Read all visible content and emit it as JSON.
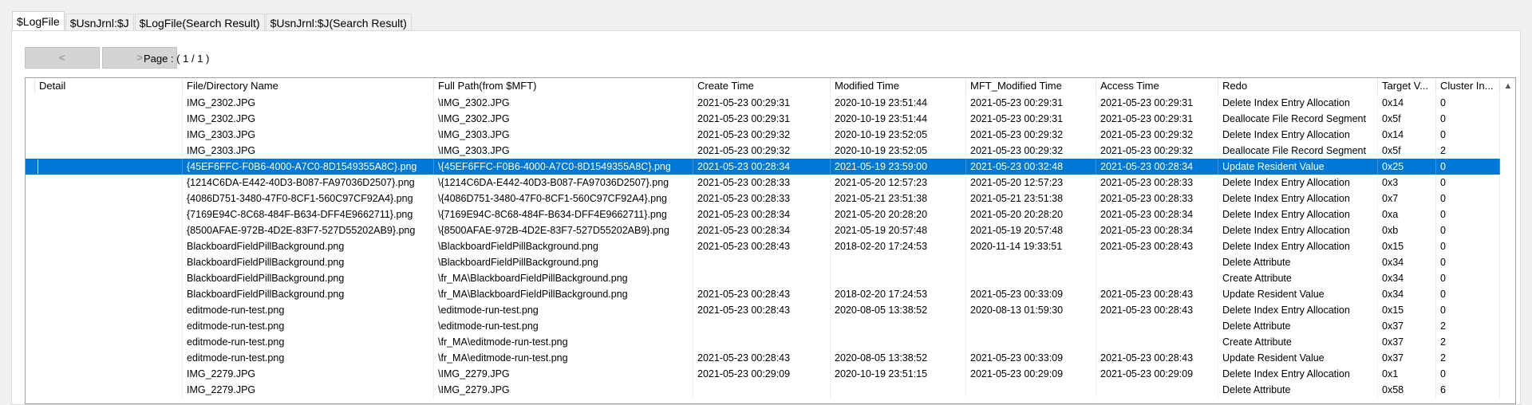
{
  "tabs": [
    "$LogFile",
    "$UsnJrnl:$J",
    "$LogFile(Search Result)",
    "$UsnJrnl:$J(Search Result)"
  ],
  "nav": {
    "prev": "<",
    "next": ">",
    "page": "Page : ( 1 / 1 )"
  },
  "table": {
    "columns": [
      "",
      "Detail",
      "File/Directory Name",
      "Full Path(from $MFT)",
      "Create Time",
      "Modified Time",
      "MFT_Modified Time",
      "Access Time",
      "Redo",
      "Target V...",
      "Cluster In..."
    ],
    "selected_row": 4,
    "rows": [
      [
        "",
        "",
        "IMG_2302.JPG",
        "\\IMG_2302.JPG",
        "2021-05-23 00:29:31",
        "2020-10-19 23:51:44",
        "2021-05-23 00:29:31",
        "2021-05-23 00:29:31",
        "Delete Index Entry Allocation",
        "0x14",
        "0"
      ],
      [
        "",
        "",
        "IMG_2302.JPG",
        "\\IMG_2302.JPG",
        "2021-05-23 00:29:31",
        "2020-10-19 23:51:44",
        "2021-05-23 00:29:31",
        "2021-05-23 00:29:31",
        "Deallocate File Record Segment",
        "0x5f",
        "0"
      ],
      [
        "",
        "",
        "IMG_2303.JPG",
        "\\IMG_2303.JPG",
        "2021-05-23 00:29:32",
        "2020-10-19 23:52:05",
        "2021-05-23 00:29:32",
        "2021-05-23 00:29:32",
        "Delete Index Entry Allocation",
        "0x14",
        "0"
      ],
      [
        "",
        "",
        "IMG_2303.JPG",
        "\\IMG_2303.JPG",
        "2021-05-23 00:29:32",
        "2020-10-19 23:52:05",
        "2021-05-23 00:29:32",
        "2021-05-23 00:29:32",
        "Deallocate File Record Segment",
        "0x5f",
        "2"
      ],
      [
        "",
        "",
        "{45EF6FFC-F0B6-4000-A7C0-8D1549355A8C}.png",
        "\\{45EF6FFC-F0B6-4000-A7C0-8D1549355A8C}.png",
        "2021-05-23 00:28:34",
        "2021-05-19 23:59:00",
        "2021-05-23 00:32:48",
        "2021-05-23 00:28:34",
        "Update Resident Value",
        "0x25",
        "0"
      ],
      [
        "",
        "",
        "{1214C6DA-E442-40D3-B087-FA97036D2507}.png",
        "\\{1214C6DA-E442-40D3-B087-FA97036D2507}.png",
        "2021-05-23 00:28:33",
        "2021-05-20 12:57:23",
        "2021-05-20 12:57:23",
        "2021-05-23 00:28:33",
        "Delete Index Entry Allocation",
        "0x3",
        "0"
      ],
      [
        "",
        "",
        "{4086D751-3480-47F0-8CF1-560C97CF92A4}.png",
        "\\{4086D751-3480-47F0-8CF1-560C97CF92A4}.png",
        "2021-05-23 00:28:33",
        "2021-05-21 23:51:38",
        "2021-05-21 23:51:38",
        "2021-05-23 00:28:33",
        "Delete Index Entry Allocation",
        "0x7",
        "0"
      ],
      [
        "",
        "",
        "{7169E94C-8C68-484F-B634-DFF4E9662711}.png",
        "\\{7169E94C-8C68-484F-B634-DFF4E9662711}.png",
        "2021-05-23 00:28:34",
        "2021-05-20 20:28:20",
        "2021-05-20 20:28:20",
        "2021-05-23 00:28:34",
        "Delete Index Entry Allocation",
        "0xa",
        "0"
      ],
      [
        "",
        "",
        "{8500AFAE-972B-4D2E-83F7-527D55202AB9}.png",
        "\\{8500AFAE-972B-4D2E-83F7-527D55202AB9}.png",
        "2021-05-23 00:28:34",
        "2021-05-19 20:57:48",
        "2021-05-19 20:57:48",
        "2021-05-23 00:28:34",
        "Delete Index Entry Allocation",
        "0xb",
        "0"
      ],
      [
        "",
        "",
        "BlackboardFieldPillBackground.png",
        "\\BlackboardFieldPillBackground.png",
        "2021-05-23 00:28:43",
        "2018-02-20 17:24:53",
        "2020-11-14 19:33:51",
        "2021-05-23 00:28:43",
        "Delete Index Entry Allocation",
        "0x15",
        "0"
      ],
      [
        "",
        "",
        "BlackboardFieldPillBackground.png",
        "\\BlackboardFieldPillBackground.png",
        "",
        "",
        "",
        "",
        "Delete Attribute",
        "0x34",
        "0"
      ],
      [
        "",
        "",
        "BlackboardFieldPillBackground.png",
        "\\fr_MA\\BlackboardFieldPillBackground.png",
        "",
        "",
        "",
        "",
        "Create Attribute",
        "0x34",
        "0"
      ],
      [
        "",
        "",
        "BlackboardFieldPillBackground.png",
        "\\fr_MA\\BlackboardFieldPillBackground.png",
        "2021-05-23 00:28:43",
        "2018-02-20 17:24:53",
        "2021-05-23 00:33:09",
        "2021-05-23 00:28:43",
        "Update Resident Value",
        "0x34",
        "0"
      ],
      [
        "",
        "",
        "editmode-run-test.png",
        "\\editmode-run-test.png",
        "2021-05-23 00:28:43",
        "2020-08-05 13:38:52",
        "2020-08-13 01:59:30",
        "2021-05-23 00:28:43",
        "Delete Index Entry Allocation",
        "0x15",
        "0"
      ],
      [
        "",
        "",
        "editmode-run-test.png",
        "\\editmode-run-test.png",
        "",
        "",
        "",
        "",
        "Delete Attribute",
        "0x37",
        "2"
      ],
      [
        "",
        "",
        "editmode-run-test.png",
        "\\fr_MA\\editmode-run-test.png",
        "",
        "",
        "",
        "",
        "Create Attribute",
        "0x37",
        "2"
      ],
      [
        "",
        "",
        "editmode-run-test.png",
        "\\fr_MA\\editmode-run-test.png",
        "2021-05-23 00:28:43",
        "2020-08-05 13:38:52",
        "2021-05-23 00:33:09",
        "2021-05-23 00:28:43",
        "Update Resident Value",
        "0x37",
        "2"
      ],
      [
        "",
        "",
        "IMG_2279.JPG",
        "\\IMG_2279.JPG",
        "2021-05-23 00:29:09",
        "2020-10-19 23:51:15",
        "2021-05-23 00:29:09",
        "2021-05-23 00:29:09",
        "Delete Index Entry Allocation",
        "0x1",
        "0"
      ],
      [
        "",
        "",
        "IMG_2279.JPG",
        "\\IMG_2279.JPG",
        "",
        "",
        "",
        "",
        "Delete Attribute",
        "0x58",
        "6"
      ]
    ]
  }
}
